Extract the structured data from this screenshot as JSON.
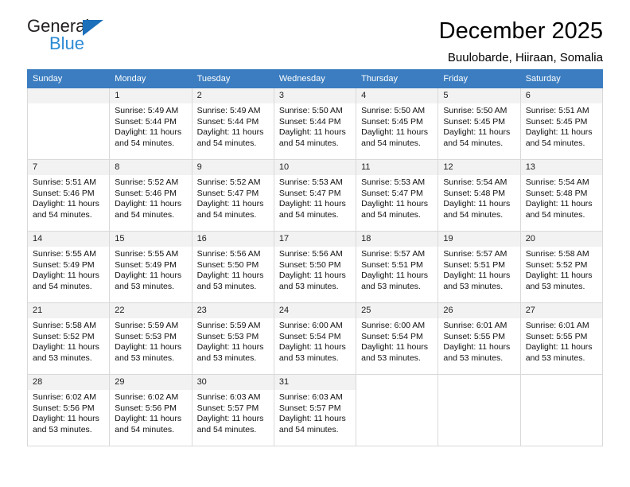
{
  "logo": {
    "word_top": "General",
    "word_bottom": "Blue",
    "triangle_color": "#1c6fba",
    "blue_color": "#2b8bd4"
  },
  "header": {
    "title": "December 2025",
    "subtitle": "Buulobarde, Hiiraan, Somalia"
  },
  "calendar": {
    "header_color": "#3b7dc0",
    "weekdays": [
      "Sunday",
      "Monday",
      "Tuesday",
      "Wednesday",
      "Thursday",
      "Friday",
      "Saturday"
    ],
    "labels": {
      "sunrise": "Sunrise:",
      "sunset": "Sunset:",
      "daylight": "Daylight:"
    },
    "weeks": [
      [
        {
          "day": "",
          "empty": true
        },
        {
          "day": "1",
          "sunrise": "Sunrise: 5:49 AM",
          "sunset": "Sunset: 5:44 PM",
          "daylight1": "Daylight: 11 hours",
          "daylight2": "and 54 minutes."
        },
        {
          "day": "2",
          "sunrise": "Sunrise: 5:49 AM",
          "sunset": "Sunset: 5:44 PM",
          "daylight1": "Daylight: 11 hours",
          "daylight2": "and 54 minutes."
        },
        {
          "day": "3",
          "sunrise": "Sunrise: 5:50 AM",
          "sunset": "Sunset: 5:44 PM",
          "daylight1": "Daylight: 11 hours",
          "daylight2": "and 54 minutes."
        },
        {
          "day": "4",
          "sunrise": "Sunrise: 5:50 AM",
          "sunset": "Sunset: 5:45 PM",
          "daylight1": "Daylight: 11 hours",
          "daylight2": "and 54 minutes."
        },
        {
          "day": "5",
          "sunrise": "Sunrise: 5:50 AM",
          "sunset": "Sunset: 5:45 PM",
          "daylight1": "Daylight: 11 hours",
          "daylight2": "and 54 minutes."
        },
        {
          "day": "6",
          "sunrise": "Sunrise: 5:51 AM",
          "sunset": "Sunset: 5:45 PM",
          "daylight1": "Daylight: 11 hours",
          "daylight2": "and 54 minutes."
        }
      ],
      [
        {
          "day": "7",
          "sunrise": "Sunrise: 5:51 AM",
          "sunset": "Sunset: 5:46 PM",
          "daylight1": "Daylight: 11 hours",
          "daylight2": "and 54 minutes."
        },
        {
          "day": "8",
          "sunrise": "Sunrise: 5:52 AM",
          "sunset": "Sunset: 5:46 PM",
          "daylight1": "Daylight: 11 hours",
          "daylight2": "and 54 minutes."
        },
        {
          "day": "9",
          "sunrise": "Sunrise: 5:52 AM",
          "sunset": "Sunset: 5:47 PM",
          "daylight1": "Daylight: 11 hours",
          "daylight2": "and 54 minutes."
        },
        {
          "day": "10",
          "sunrise": "Sunrise: 5:53 AM",
          "sunset": "Sunset: 5:47 PM",
          "daylight1": "Daylight: 11 hours",
          "daylight2": "and 54 minutes."
        },
        {
          "day": "11",
          "sunrise": "Sunrise: 5:53 AM",
          "sunset": "Sunset: 5:47 PM",
          "daylight1": "Daylight: 11 hours",
          "daylight2": "and 54 minutes."
        },
        {
          "day": "12",
          "sunrise": "Sunrise: 5:54 AM",
          "sunset": "Sunset: 5:48 PM",
          "daylight1": "Daylight: 11 hours",
          "daylight2": "and 54 minutes."
        },
        {
          "day": "13",
          "sunrise": "Sunrise: 5:54 AM",
          "sunset": "Sunset: 5:48 PM",
          "daylight1": "Daylight: 11 hours",
          "daylight2": "and 54 minutes."
        }
      ],
      [
        {
          "day": "14",
          "sunrise": "Sunrise: 5:55 AM",
          "sunset": "Sunset: 5:49 PM",
          "daylight1": "Daylight: 11 hours",
          "daylight2": "and 54 minutes."
        },
        {
          "day": "15",
          "sunrise": "Sunrise: 5:55 AM",
          "sunset": "Sunset: 5:49 PM",
          "daylight1": "Daylight: 11 hours",
          "daylight2": "and 53 minutes."
        },
        {
          "day": "16",
          "sunrise": "Sunrise: 5:56 AM",
          "sunset": "Sunset: 5:50 PM",
          "daylight1": "Daylight: 11 hours",
          "daylight2": "and 53 minutes."
        },
        {
          "day": "17",
          "sunrise": "Sunrise: 5:56 AM",
          "sunset": "Sunset: 5:50 PM",
          "daylight1": "Daylight: 11 hours",
          "daylight2": "and 53 minutes."
        },
        {
          "day": "18",
          "sunrise": "Sunrise: 5:57 AM",
          "sunset": "Sunset: 5:51 PM",
          "daylight1": "Daylight: 11 hours",
          "daylight2": "and 53 minutes."
        },
        {
          "day": "19",
          "sunrise": "Sunrise: 5:57 AM",
          "sunset": "Sunset: 5:51 PM",
          "daylight1": "Daylight: 11 hours",
          "daylight2": "and 53 minutes."
        },
        {
          "day": "20",
          "sunrise": "Sunrise: 5:58 AM",
          "sunset": "Sunset: 5:52 PM",
          "daylight1": "Daylight: 11 hours",
          "daylight2": "and 53 minutes."
        }
      ],
      [
        {
          "day": "21",
          "sunrise": "Sunrise: 5:58 AM",
          "sunset": "Sunset: 5:52 PM",
          "daylight1": "Daylight: 11 hours",
          "daylight2": "and 53 minutes."
        },
        {
          "day": "22",
          "sunrise": "Sunrise: 5:59 AM",
          "sunset": "Sunset: 5:53 PM",
          "daylight1": "Daylight: 11 hours",
          "daylight2": "and 53 minutes."
        },
        {
          "day": "23",
          "sunrise": "Sunrise: 5:59 AM",
          "sunset": "Sunset: 5:53 PM",
          "daylight1": "Daylight: 11 hours",
          "daylight2": "and 53 minutes."
        },
        {
          "day": "24",
          "sunrise": "Sunrise: 6:00 AM",
          "sunset": "Sunset: 5:54 PM",
          "daylight1": "Daylight: 11 hours",
          "daylight2": "and 53 minutes."
        },
        {
          "day": "25",
          "sunrise": "Sunrise: 6:00 AM",
          "sunset": "Sunset: 5:54 PM",
          "daylight1": "Daylight: 11 hours",
          "daylight2": "and 53 minutes."
        },
        {
          "day": "26",
          "sunrise": "Sunrise: 6:01 AM",
          "sunset": "Sunset: 5:55 PM",
          "daylight1": "Daylight: 11 hours",
          "daylight2": "and 53 minutes."
        },
        {
          "day": "27",
          "sunrise": "Sunrise: 6:01 AM",
          "sunset": "Sunset: 5:55 PM",
          "daylight1": "Daylight: 11 hours",
          "daylight2": "and 53 minutes."
        }
      ],
      [
        {
          "day": "28",
          "sunrise": "Sunrise: 6:02 AM",
          "sunset": "Sunset: 5:56 PM",
          "daylight1": "Daylight: 11 hours",
          "daylight2": "and 53 minutes."
        },
        {
          "day": "29",
          "sunrise": "Sunrise: 6:02 AM",
          "sunset": "Sunset: 5:56 PM",
          "daylight1": "Daylight: 11 hours",
          "daylight2": "and 54 minutes."
        },
        {
          "day": "30",
          "sunrise": "Sunrise: 6:03 AM",
          "sunset": "Sunset: 5:57 PM",
          "daylight1": "Daylight: 11 hours",
          "daylight2": "and 54 minutes."
        },
        {
          "day": "31",
          "sunrise": "Sunrise: 6:03 AM",
          "sunset": "Sunset: 5:57 PM",
          "daylight1": "Daylight: 11 hours",
          "daylight2": "and 54 minutes."
        },
        {
          "day": "",
          "blank": true
        },
        {
          "day": "",
          "blank": true
        },
        {
          "day": "",
          "blank": true
        }
      ]
    ]
  }
}
